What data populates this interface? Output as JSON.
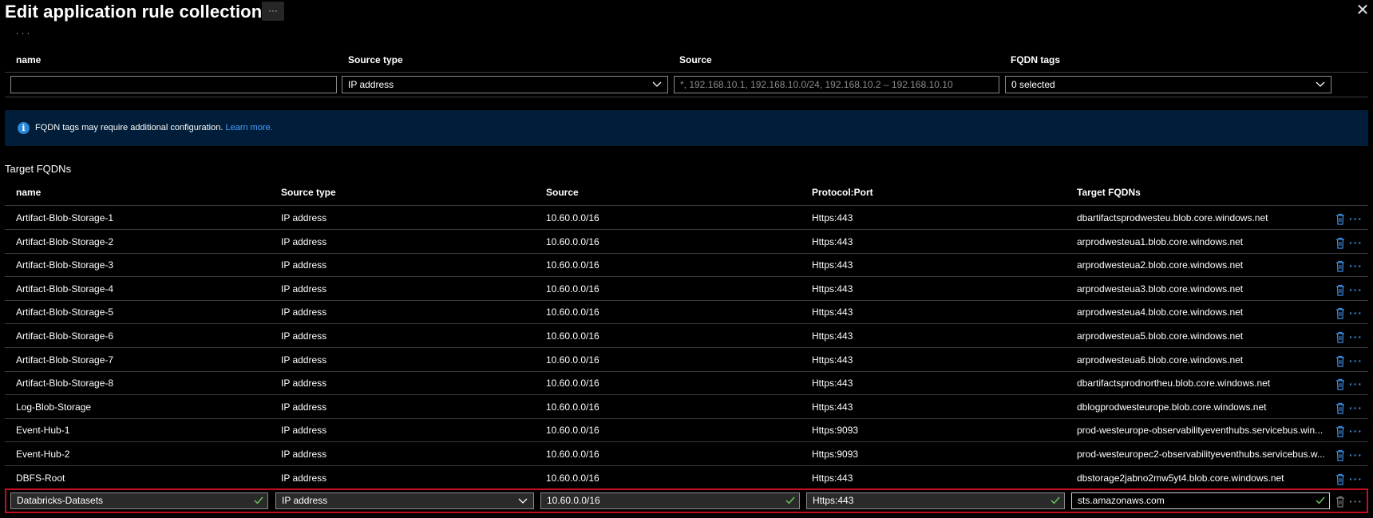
{
  "header": {
    "title": "Edit application rule collection",
    "more_label": "···",
    "close_label": "✕"
  },
  "fqdn_tags_section": {
    "columns": [
      "name",
      "Source type",
      "Source",
      "FQDN tags"
    ],
    "inputs": {
      "name": "",
      "source_type": "IP address",
      "source_placeholder": "*, 192.168.10.1, 192.168.10.0/24, 192.168.10.2 – 192.168.10.10",
      "fqdn_tags": "0 selected"
    }
  },
  "info_bar": {
    "text": "FQDN tags may require additional configuration.",
    "link": "Learn more."
  },
  "target_fqdns": {
    "section_title": "Target FQDNs",
    "columns": [
      "name",
      "Source type",
      "Source",
      "Protocol:Port",
      "Target FQDNs"
    ],
    "rows": [
      {
        "name": "Artifact-Blob-Storage-1",
        "source_type": "IP address",
        "source": "10.60.0.0/16",
        "protocol_port": "Https:443",
        "target": "dbartifactsprodwesteu.blob.core.windows.net"
      },
      {
        "name": "Artifact-Blob-Storage-2",
        "source_type": "IP address",
        "source": "10.60.0.0/16",
        "protocol_port": "Https:443",
        "target": "arprodwesteua1.blob.core.windows.net"
      },
      {
        "name": "Artifact-Blob-Storage-3",
        "source_type": "IP address",
        "source": "10.60.0.0/16",
        "protocol_port": "Https:443",
        "target": "arprodwesteua2.blob.core.windows.net"
      },
      {
        "name": "Artifact-Blob-Storage-4",
        "source_type": "IP address",
        "source": "10.60.0.0/16",
        "protocol_port": "Https:443",
        "target": "arprodwesteua3.blob.core.windows.net"
      },
      {
        "name": "Artifact-Blob-Storage-5",
        "source_type": "IP address",
        "source": "10.60.0.0/16",
        "protocol_port": "Https:443",
        "target": "arprodwesteua4.blob.core.windows.net"
      },
      {
        "name": "Artifact-Blob-Storage-6",
        "source_type": "IP address",
        "source": "10.60.0.0/16",
        "protocol_port": "Https:443",
        "target": "arprodwesteua5.blob.core.windows.net"
      },
      {
        "name": "Artifact-Blob-Storage-7",
        "source_type": "IP address",
        "source": "10.60.0.0/16",
        "protocol_port": "Https:443",
        "target": "arprodwesteua6.blob.core.windows.net"
      },
      {
        "name": "Artifact-Blob-Storage-8",
        "source_type": "IP address",
        "source": "10.60.0.0/16",
        "protocol_port": "Https:443",
        "target": "dbartifactsprodnortheu.blob.core.windows.net"
      },
      {
        "name": "Log-Blob-Storage",
        "source_type": "IP address",
        "source": "10.60.0.0/16",
        "protocol_port": "Https:443",
        "target": "dblogprodwesteurope.blob.core.windows.net"
      },
      {
        "name": "Event-Hub-1",
        "source_type": "IP address",
        "source": "10.60.0.0/16",
        "protocol_port": "Https:9093",
        "target": "prod-westeurope-observabilityeventhubs.servicebus.win..."
      },
      {
        "name": "Event-Hub-2",
        "source_type": "IP address",
        "source": "10.60.0.0/16",
        "protocol_port": "Https:9093",
        "target": "prod-westeuropec2-observabilityeventhubs.servicebus.w..."
      },
      {
        "name": "DBFS-Root",
        "source_type": "IP address",
        "source": "10.60.0.0/16",
        "protocol_port": "Https:443",
        "target": "dbstorage2jabno2mw5yt4.blob.core.windows.net"
      }
    ],
    "edit_row": {
      "name": "Databricks-Datasets",
      "source_type": "IP address",
      "source": "10.60.0.0/16",
      "protocol_port": "Https:443",
      "target": "sts.amazonaws.com"
    }
  },
  "colors": {
    "accent": "#3e8ee6",
    "info_bg": "#001d39",
    "highlight_border": "#c50f1f",
    "valid_check": "#6ccb5f"
  },
  "icons": {
    "info": "info-icon",
    "delete": "trash-icon",
    "more": "ellipsis-icon",
    "dropdown": "chevron-down-icon",
    "valid": "checkmark-icon"
  }
}
